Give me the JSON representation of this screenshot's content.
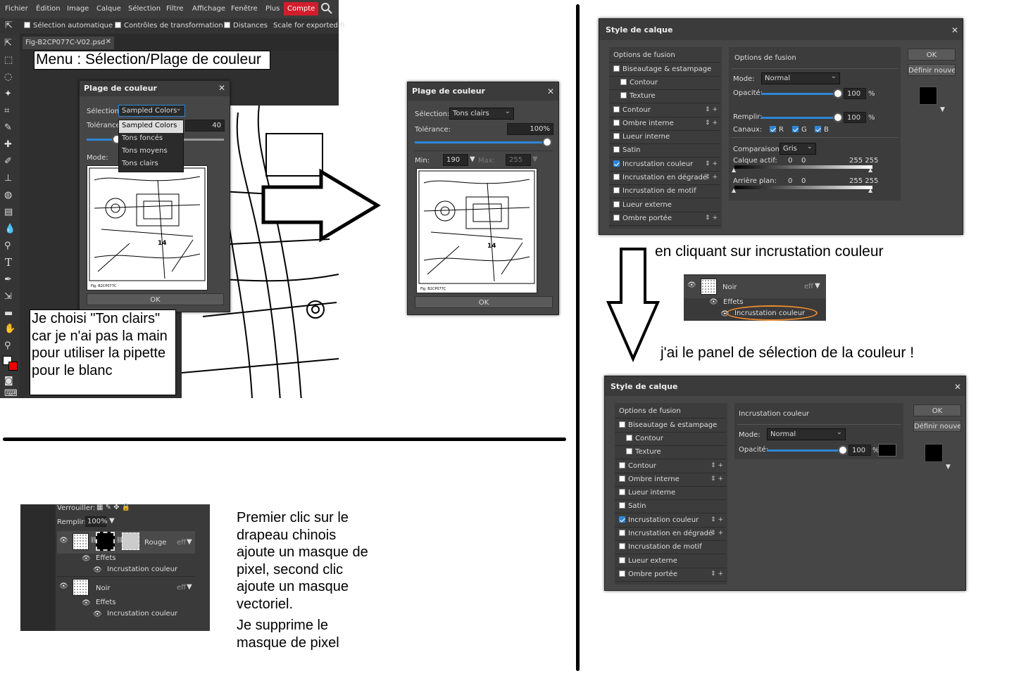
{
  "menubar": [
    "Fichier",
    "Édition",
    "Image",
    "Calque",
    "Sélection",
    "Filtre",
    "Affichage",
    "Fenêtre",
    "Plus",
    "Compte"
  ],
  "optionsbar": {
    "auto_select": "Sélection automatique",
    "transform": "Contrôles de transformation",
    "distances": "Distances",
    "scale": "Scale for exported fi"
  },
  "doc_tab": "Fig-B2CP077C-V02.psd",
  "caption_menu": "Menu : Sélection/Plage de couleur",
  "dlg1": {
    "title": "Plage de couleur",
    "selection_label": "Sélection:",
    "selection_value": "Sampled Colors",
    "tolerance_label": "Tolérance",
    "tolerance_value": "40",
    "mode_label": "Mode:",
    "options": [
      "Sampled Colors",
      "Tons foncés",
      "Tons moyens",
      "Tons clairs"
    ],
    "ok": "OK",
    "fig": "Fig. B2CP077C",
    "num": "14"
  },
  "caption_ton": "Je choisi \"Ton clairs\" car je n'ai pas la main pour utiliser la pipette pour le blanc",
  "dlg2": {
    "title": "Plage de couleur",
    "selection_label": "Sélection:",
    "selection_value": "Tons clairs",
    "tolerance_label": "Tolérance:",
    "tolerance_value": "100%",
    "min_label": "Min:",
    "min_value": "190",
    "max_label": "Max:",
    "max_value": "255",
    "ok": "OK",
    "fig": "Fig. B2CP077C",
    "num": "14"
  },
  "style1": {
    "title": "Style de calque",
    "list_header": "Options de fusion",
    "items": [
      "Biseautage & estampage",
      "Contour",
      "Texture",
      "Contour",
      "Ombre interne",
      "Lueur interne",
      "Satin",
      "Incrustation couleur",
      "Incrustation en dégradé",
      "Incrustation de motif",
      "Lueur externe",
      "Ombre portée"
    ],
    "section": "Options de fusion",
    "mode_label": "Mode:",
    "mode_value": "Normal",
    "opacity_label": "Opacité:",
    "opacity_value": "100",
    "pct": "%",
    "fill_label": "Remplir:",
    "fill_value": "100",
    "channels_label": "Canaux:",
    "r": "R",
    "g": "G",
    "b": "B",
    "compare_label": "Comparaison:",
    "compare_value": "Gris",
    "active_label": "Calque actif:",
    "active_a": "0",
    "active_b": "0",
    "active_c": "255 255",
    "under_label": "Arrière plan:",
    "under_a": "0",
    "under_b": "0",
    "under_c": "255 255",
    "ok": "OK",
    "define": "Définir nouvea"
  },
  "caption_click": "en cliquant sur incrustation couleur",
  "layer_mini": {
    "name": "Noir",
    "eff": "eff",
    "effects": "Effets",
    "item": "Incrustation couleur"
  },
  "caption_panel": "j'ai le panel de sélection de la couleur !",
  "style2": {
    "title": "Style de calque",
    "list_header": "Options de fusion",
    "items": [
      "Biseautage & estampage",
      "Contour",
      "Texture",
      "Contour",
      "Ombre interne",
      "Lueur interne",
      "Satin",
      "Incrustation couleur",
      "Incrustation en dégradé",
      "Incrustation de motif",
      "Lueur externe",
      "Ombre portée"
    ],
    "section": "Incrustation couleur",
    "mode_label": "Mode:",
    "mode_value": "Normal",
    "opacity_label": "Opacité:",
    "opacity_value": "100",
    "pct": "%",
    "ok": "OK",
    "define": "Définir nouvea"
  },
  "layers": {
    "lock": "Verrouiller:",
    "fill_label": "Remplir:",
    "fill_value": "100%",
    "layer1": "Rouge",
    "layer2": "Noir",
    "eff": "eff",
    "effects": "Effets",
    "effect_item": "Incrustation couleur"
  },
  "caption_mask": "Premier clic sur le drapeau chinois ajoute un masque de pixel, second clic ajoute un masque vectoriel.",
  "caption_delete": "Je supprime le masque de pixel"
}
